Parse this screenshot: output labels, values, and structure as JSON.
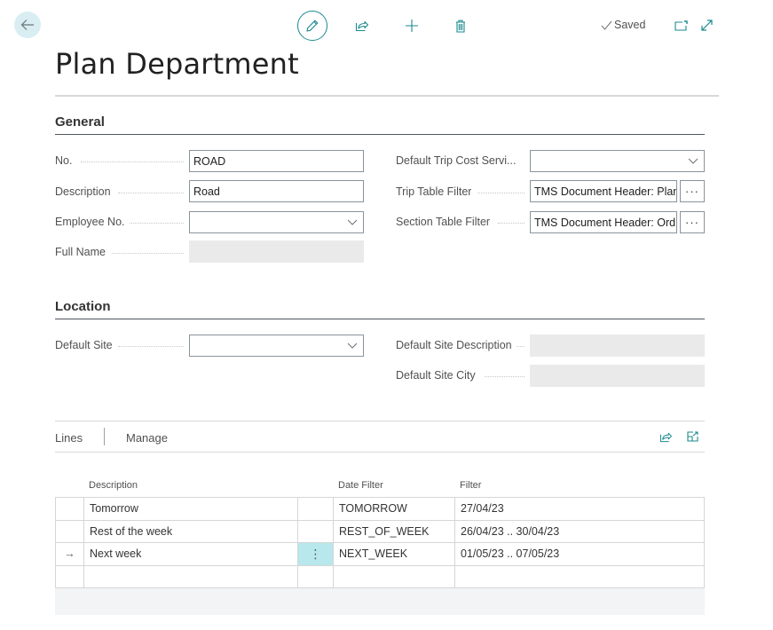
{
  "header": {
    "back_label": "Back",
    "saved_label": "Saved",
    "icons": {
      "back": "arrow-left-icon",
      "edit": "pencil-icon",
      "share": "share-icon",
      "new": "plus-icon",
      "delete": "trash-icon",
      "saved": "checkmark-icon",
      "popout": "open-in-new-window-icon",
      "expand": "expand-icon"
    }
  },
  "page": {
    "title": "Plan Department"
  },
  "general": {
    "title": "General",
    "left_fields": [
      {
        "label": "No.",
        "value": "ROAD",
        "type": "text"
      },
      {
        "label": "Description",
        "value": "Road",
        "type": "text"
      },
      {
        "label": "Employee No.",
        "value": "",
        "type": "dropdown"
      },
      {
        "label": "Full Name",
        "value": "",
        "type": "readonly"
      }
    ],
    "right_fields": [
      {
        "label": "Default Trip Cost Servi...",
        "value": "",
        "type": "dropdown"
      },
      {
        "label": "Trip Table Filter",
        "value": "TMS Document Header: Plan",
        "type": "assist",
        "assist_label": "···"
      },
      {
        "label": "Section Table Filter",
        "value": "TMS Document Header: Ord",
        "type": "assist",
        "assist_label": "···"
      }
    ]
  },
  "location": {
    "title": "Location",
    "left_fields": [
      {
        "label": "Default Site",
        "value": "",
        "type": "dropdown"
      }
    ],
    "right_fields": [
      {
        "label": "Default Site Description",
        "value": "",
        "type": "readonly"
      },
      {
        "label": "Default Site City",
        "value": "",
        "type": "readonly"
      }
    ]
  },
  "lines": {
    "tab_label": "Lines",
    "manage_label": "Manage",
    "columns": [
      "Description",
      "Date Filter",
      "Filter"
    ],
    "rows": [
      {
        "selected": false,
        "description": "Tomorrow",
        "date_filter": "TOMORROW",
        "filter": "27/04/23"
      },
      {
        "selected": false,
        "description": "Rest of the week",
        "date_filter": "REST_OF_WEEK",
        "filter": "26/04/23 .. 30/04/23"
      },
      {
        "selected": true,
        "description": "Next week",
        "date_filter": "NEXT_WEEK",
        "filter": "01/05/23 .. 07/05/23",
        "row_marker": "→",
        "actions_label": "⋮"
      },
      {
        "selected": false,
        "description": "",
        "date_filter": "",
        "filter": ""
      }
    ]
  },
  "colors": {
    "accent": "#1b8a8f",
    "back_button_bg": "#d9eef2",
    "active_cell_bg": "#b8e8ec",
    "readonly_bg": "#eaeaea"
  }
}
